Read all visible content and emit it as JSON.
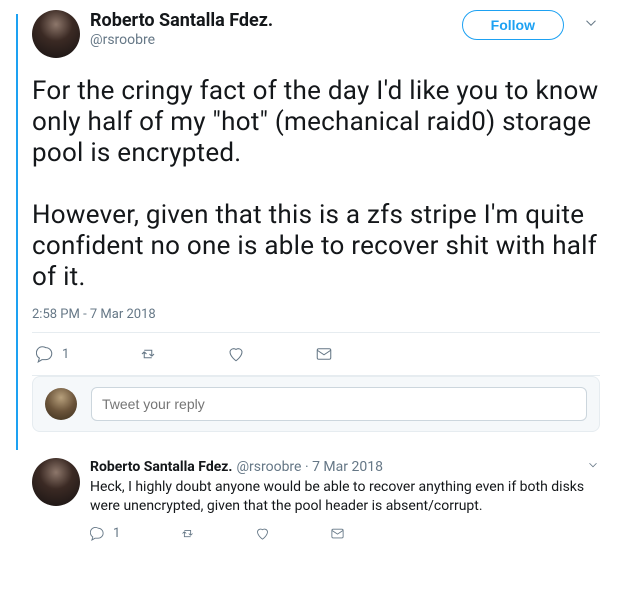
{
  "main": {
    "author_name": "Roberto Santalla Fdez.",
    "author_handle": "@rsroobre",
    "follow_label": "Follow",
    "tweet_text": "For the cringy fact of the day I'd like you to know only half of my \"hot\" (mechanical raid0) storage pool is encrypted.\n\nHowever, given that this is a zfs stripe I'm quite confident no one is able to recover shit with half of it.",
    "timestamp": "2:58 PM - 7 Mar 2018",
    "reply_count": "1",
    "reply_placeholder": "Tweet your reply"
  },
  "reply": {
    "author_name": "Roberto Santalla Fdez.",
    "author_handle": "@rsroobre",
    "date": "7 Mar 2018",
    "text": "Heck, I highly doubt anyone would be able to recover anything even if both disks were unencrypted, given that the pool header is absent/corrupt.",
    "reply_count": "1"
  }
}
